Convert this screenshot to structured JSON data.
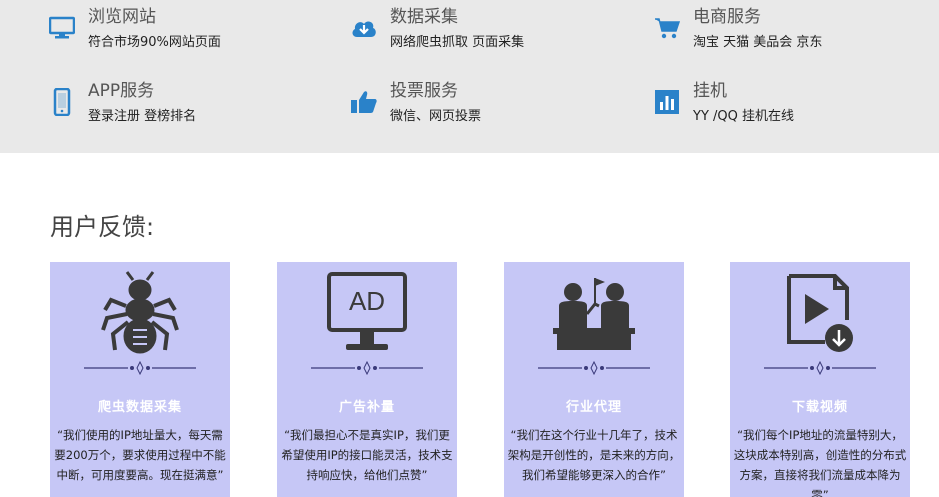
{
  "services": [
    {
      "icon": "monitor-icon",
      "title": "浏览网站",
      "desc": "符合市场90%网站页面"
    },
    {
      "icon": "cloud-download-icon",
      "title": "数据采集",
      "desc": "网络爬虫抓取 页面采集"
    },
    {
      "icon": "shopping-cart-icon",
      "title": "电商服务",
      "desc": "淘宝 天猫 美品会 京东"
    },
    {
      "icon": "smartphone-icon",
      "title": "APP服务",
      "desc": "登录注册 登榜排名"
    },
    {
      "icon": "thumbs-up-icon",
      "title": "投票服务",
      "desc": "微信、网页投票"
    },
    {
      "icon": "bar-chart-icon",
      "title": "挂机",
      "desc": "YY /QQ 挂机在线"
    }
  ],
  "feedback": {
    "title": "用户反馈:",
    "cards": [
      {
        "icon": "ant-icon",
        "title": "爬虫数据采集",
        "text": "“我们使用的IP地址量大，每天需要200万个，要求使用过程中不能中断，可用度要高。现在挺满意”"
      },
      {
        "icon": "ad-monitor-icon",
        "title": "广告补量",
        "text": "“我们最担心不是真实IP，我们更希望使用IP的接口能灵活，技术支持响应快，给他们点赞”",
        "ad_label": "AD"
      },
      {
        "icon": "agent-meeting-icon",
        "title": "行业代理",
        "text": "“我们在这个行业十几年了，技术架构是开创性的，是未来的方向，我们希望能够更深入的合作”"
      },
      {
        "icon": "video-download-icon",
        "title": "下载视频",
        "text": "“我们每个IP地址的流量特别大，这块成本特别高，创造性的分布式方案，直接将我们流量成本降为零”"
      }
    ]
  },
  "colors": {
    "icon_blue": "#2a82c9",
    "card_bg": "#c6c7f6",
    "band_bg": "#e9e9e9",
    "dark_icon": "#3a3a3a"
  }
}
